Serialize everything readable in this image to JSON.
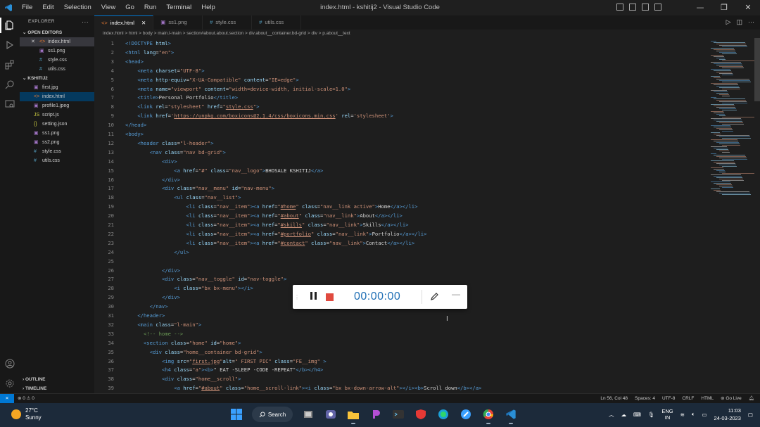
{
  "window": {
    "title": "index.html - kshitij2 - Visual Studio Code",
    "menu": [
      "File",
      "Edit",
      "Selection",
      "View",
      "Go",
      "Run",
      "Terminal",
      "Help"
    ]
  },
  "explorer": {
    "header": "EXPLORER",
    "open_editors_label": "OPEN EDITORS",
    "open_editors": [
      {
        "name": "index.html",
        "type": "html"
      },
      {
        "name": "ss1.png",
        "type": "png"
      },
      {
        "name": "style.css",
        "type": "css"
      },
      {
        "name": "utils.css",
        "type": "css"
      }
    ],
    "folder_label": "KSHITIJ2",
    "files": [
      {
        "name": "first.jpg",
        "type": "jpg",
        "icon": "▣"
      },
      {
        "name": "index.html",
        "type": "html",
        "icon": "<>"
      },
      {
        "name": "profile1.jpeg",
        "type": "jpg",
        "icon": "▣"
      },
      {
        "name": "script.js",
        "type": "js",
        "icon": "JS"
      },
      {
        "name": "setting.json",
        "type": "json",
        "icon": "{}"
      },
      {
        "name": "ss1.png",
        "type": "png",
        "icon": "▣"
      },
      {
        "name": "ss2.png",
        "type": "png",
        "icon": "▣"
      },
      {
        "name": "style.css",
        "type": "css",
        "icon": "#"
      },
      {
        "name": "utils.css",
        "type": "css",
        "icon": "#"
      }
    ],
    "outline_label": "OUTLINE",
    "timeline_label": "TIMELINE"
  },
  "tabs": [
    {
      "name": "index.html",
      "icon": "<>",
      "active": true
    },
    {
      "name": "ss1.png",
      "icon": "▣",
      "active": false
    },
    {
      "name": "style.css",
      "icon": "#",
      "active": false
    },
    {
      "name": "utils.css",
      "icon": "#",
      "active": false
    }
  ],
  "breadcrumb": "index.html > html > body > main.l-main > section#about.about.section > div.about__container.bd-grid > div > p.about__text",
  "code": [
    {
      "n": "1",
      "html": "<span class=\"tg\">&lt;!DOCTYPE</span> <span class=\"at\">html</span><span class=\"tg\">&gt;</span>"
    },
    {
      "n": "2",
      "html": "<span class=\"tg\">&lt;html</span> <span class=\"at\">lang</span><span class=\"tx\">=</span><span class=\"st\">\"en\"</span><span class=\"tg\">&gt;</span>"
    },
    {
      "n": "3",
      "html": "<span class=\"tg\">&lt;head&gt;</span>"
    },
    {
      "n": "4",
      "html": "    <span class=\"tg\">&lt;meta</span> <span class=\"at\">charset</span><span class=\"tx\">=</span><span class=\"st\">\"UTF-8\"</span><span class=\"tg\">&gt;</span>"
    },
    {
      "n": "5",
      "html": "    <span class=\"tg\">&lt;meta</span> <span class=\"at\">http-equiv</span><span class=\"tx\">=</span><span class=\"st\">\"X-UA-Compatible\"</span> <span class=\"at\">content</span><span class=\"tx\">=</span><span class=\"st\">\"IE=edge\"</span><span class=\"tg\">&gt;</span>"
    },
    {
      "n": "6",
      "html": "    <span class=\"tg\">&lt;meta</span> <span class=\"at\">name</span><span class=\"tx\">=</span><span class=\"st\">\"viewport\"</span> <span class=\"at\">content</span><span class=\"tx\">=</span><span class=\"st\">\"width=device-width, initial-scale=1.0\"</span><span class=\"tg\">&gt;</span>"
    },
    {
      "n": "7",
      "html": "    <span class=\"tg\">&lt;title&gt;</span><span class=\"tx\">Personal Portfolio</span><span class=\"tg\">&lt;/title&gt;</span>"
    },
    {
      "n": "8",
      "html": "    <span class=\"tg\">&lt;link</span> <span class=\"at\">rel</span><span class=\"tx\">=</span><span class=\"st\">\"stylesheet\"</span> <span class=\"at\">href</span><span class=\"tx\">=</span><span class=\"st\">\"<u>style.css</u>\"</span><span class=\"tg\">&gt;</span>"
    },
    {
      "n": "9",
      "html": "    <span class=\"tg\">&lt;link</span> <span class=\"at\">href</span><span class=\"tx\">=</span><span class=\"st\">'<u>https://unpkg.com/boxicons@2.1.4/css/boxicons.min.css</u>'</span> <span class=\"at\">rel</span><span class=\"tx\">=</span><span class=\"st\">'stylesheet'</span><span class=\"tg\">&gt;</span>"
    },
    {
      "n": "10",
      "html": "<span class=\"tg\">&lt;/head&gt;</span>"
    },
    {
      "n": "11",
      "html": "<span class=\"tg\">&lt;body&gt;</span>"
    },
    {
      "n": "12",
      "html": "    <span class=\"tg\">&lt;header</span> <span class=\"at\">class</span><span class=\"tx\">=</span><span class=\"st\">\"l-header\"</span><span class=\"tg\">&gt;</span>"
    },
    {
      "n": "13",
      "html": "        <span class=\"tg\">&lt;nav</span> <span class=\"at\">class</span><span class=\"tx\">=</span><span class=\"st\">\"nav bd-grid\"</span><span class=\"tg\">&gt;</span>"
    },
    {
      "n": "14",
      "html": "            <span class=\"tg\">&lt;div&gt;</span>"
    },
    {
      "n": "15",
      "html": "                <span class=\"tg\">&lt;a</span> <span class=\"at\">href</span><span class=\"tx\">=</span><span class=\"st\">\"#\"</span> <span class=\"at\">class</span><span class=\"tx\">=</span><span class=\"st\">\"nav__logo\"</span><span class=\"tg\">&gt;</span><span class=\"tx\">BHOSALE KSHITIJ</span><span class=\"tg\">&lt;/a&gt;</span>"
    },
    {
      "n": "16",
      "html": "            <span class=\"tg\">&lt;/div&gt;</span>"
    },
    {
      "n": "17",
      "html": "            <span class=\"tg\">&lt;div</span> <span class=\"at\">class</span><span class=\"tx\">=</span><span class=\"st\">\"nav__menu\"</span> <span class=\"at\">id</span><span class=\"tx\">=</span><span class=\"st\">\"nav-menu\"</span><span class=\"tg\">&gt;</span>"
    },
    {
      "n": "18",
      "html": "                <span class=\"tg\">&lt;ul</span> <span class=\"at\">class</span><span class=\"tx\">=</span><span class=\"st\">\"nav__list\"</span><span class=\"tg\">&gt;</span>"
    },
    {
      "n": "19",
      "html": "                    <span class=\"tg\">&lt;li</span> <span class=\"at\">class</span><span class=\"tx\">=</span><span class=\"st\">\"nav__item\"</span><span class=\"tg\">&gt;&lt;a</span> <span class=\"at\">href</span><span class=\"tx\">=</span><span class=\"st\">\"<u>#home</u>\"</span> <span class=\"at\">class</span><span class=\"tx\">=</span><span class=\"st\">\"nav__link active\"</span><span class=\"tg\">&gt;</span><span class=\"tx\">Home</span><span class=\"tg\">&lt;/a&gt;&lt;/li&gt;</span>"
    },
    {
      "n": "20",
      "html": "                    <span class=\"tg\">&lt;li</span> <span class=\"at\">class</span><span class=\"tx\">=</span><span class=\"st\">\"nav__item\"</span><span class=\"tg\">&gt;&lt;a</span> <span class=\"at\">href</span><span class=\"tx\">=</span><span class=\"st\">\"<u>#about</u>\"</span> <span class=\"at\">class</span><span class=\"tx\">=</span><span class=\"st\">\"nav__link\"</span><span class=\"tg\">&gt;</span><span class=\"tx\">About</span><span class=\"tg\">&lt;/a&gt;&lt;/li&gt;</span>"
    },
    {
      "n": "21",
      "html": "                    <span class=\"tg\">&lt;li</span> <span class=\"at\">class</span><span class=\"tx\">=</span><span class=\"st\">\"nav__item\"</span><span class=\"tg\">&gt;&lt;a</span> <span class=\"at\">href</span><span class=\"tx\">=</span><span class=\"st\">\"<u>#skills</u>\"</span> <span class=\"at\">class</span><span class=\"tx\">=</span><span class=\"st\">\"nav__link\"</span><span class=\"tg\">&gt;</span><span class=\"tx\">Skills</span><span class=\"tg\">&lt;/a&gt;&lt;/li&gt;</span>"
    },
    {
      "n": "22",
      "html": "                    <span class=\"tg\">&lt;li</span> <span class=\"at\">class</span><span class=\"tx\">=</span><span class=\"st\">\"nav__item\"</span><span class=\"tg\">&gt;&lt;a</span> <span class=\"at\">href</span><span class=\"tx\">=</span><span class=\"st\">\"<u>#portfolio</u>\"</span> <span class=\"at\">class</span><span class=\"tx\">=</span><span class=\"st\">\"nav__link\"</span><span class=\"tg\">&gt;</span><span class=\"tx\">Portfolio</span><span class=\"tg\">&lt;/a&gt;&lt;/li&gt;</span>"
    },
    {
      "n": "23",
      "html": "                    <span class=\"tg\">&lt;li</span> <span class=\"at\">class</span><span class=\"tx\">=</span><span class=\"st\">\"nav__item\"</span><span class=\"tg\">&gt;&lt;a</span> <span class=\"at\">href</span><span class=\"tx\">=</span><span class=\"st\">\"<u>#contact</u>\"</span> <span class=\"at\">class</span><span class=\"tx\">=</span><span class=\"st\">\"nav__link\"</span><span class=\"tg\">&gt;</span><span class=\"tx\">Contact</span><span class=\"tg\">&lt;/a&gt;&lt;/li&gt;</span>"
    },
    {
      "n": "24",
      "html": "                <span class=\"tg\">&lt;/ul&gt;</span>"
    },
    {
      "n": "25",
      "html": ""
    },
    {
      "n": "26",
      "html": "            <span class=\"tg\">&lt;/div&gt;</span>"
    },
    {
      "n": "27",
      "html": "            <span class=\"tg\">&lt;div</span> <span class=\"at\">class</span><span class=\"tx\">=</span><span class=\"st\">\"nav__toggle\"</span> <span class=\"at\">id</span><span class=\"tx\">=</span><span class=\"st\">\"nav-toggle\"</span><span class=\"tg\">&gt;</span>"
    },
    {
      "n": "28",
      "html": "                <span class=\"tg\">&lt;i</span> <span class=\"at\">class</span><span class=\"tx\">=</span><span class=\"st\">\"bx bx-menu\"</span><span class=\"tg\">&gt;&lt;/i&gt;</span>"
    },
    {
      "n": "29",
      "html": "            <span class=\"tg\">&lt;/div&gt;</span>"
    },
    {
      "n": "30",
      "html": "        <span class=\"tg\">&lt;/nav&gt;</span>"
    },
    {
      "n": "31",
      "html": "    <span class=\"tg\">&lt;/header&gt;</span>"
    },
    {
      "n": "32",
      "html": "    <span class=\"tg\">&lt;main</span> <span class=\"at\">class</span><span class=\"tx\">=</span><span class=\"st\">\"l-main\"</span><span class=\"tg\">&gt;</span>"
    },
    {
      "n": "33",
      "html": "      <span class=\"cm\">&lt;!-- home --&gt;</span>"
    },
    {
      "n": "34",
      "html": "      <span class=\"tg\">&lt;section</span> <span class=\"at\">class</span><span class=\"tx\">=</span><span class=\"st\">\"home\"</span> <span class=\"at\">id</span><span class=\"tx\">=</span><span class=\"st\">\"home\"</span><span class=\"tg\">&gt;</span>"
    },
    {
      "n": "35",
      "html": "        <span class=\"tg\">&lt;div</span> <span class=\"at\">class</span><span class=\"tx\">=</span><span class=\"st\">\"home__container bd-grid\"</span><span class=\"tg\">&gt;</span>"
    },
    {
      "n": "36",
      "html": "            <span class=\"tg\">&lt;img</span> <span class=\"at\">src</span><span class=\"tx\">=</span><span class=\"st\">\"<u>first.jpg</u>\"</span><span class=\"at\">alt</span><span class=\"tx\">=</span><span class=\"st\">\" FIRST PIC\"</span> <span class=\"at\">class</span><span class=\"tx\">=</span><span class=\"st\">\"FE__img\"</span> <span class=\"tg\">&gt;</span>"
    },
    {
      "n": "37",
      "html": "            <span class=\"tg\">&lt;h4</span> <span class=\"at\">class</span><span class=\"tx\">=</span><span class=\"st\">\"a\"</span><span class=\"tg\">&gt;&lt;b&gt;</span><span class=\"tx\">\" EAT -SLEEP -CODE -REPEAT\"</span><span class=\"tg\">&lt;/b&gt;&lt;/h4&gt;</span>"
    },
    {
      "n": "38",
      "html": "            <span class=\"tg\">&lt;div</span> <span class=\"at\">class</span><span class=\"tx\">=</span><span class=\"st\">\"home__scroll\"</span><span class=\"tg\">&gt;</span>"
    },
    {
      "n": "39",
      "html": "                <span class=\"tg\">&lt;a</span> <span class=\"at\">href</span><span class=\"tx\">=</span><span class=\"st\">\"<u>#about</u>\"</span> <span class=\"at\">class</span><span class=\"tx\">=</span><span class=\"st\">\"home__scroll-link\"</span><span class=\"tg\">&gt;&lt;i</span> <span class=\"at\">class</span><span class=\"tx\">=</span><span class=\"st\">\"bx bx-down-arrow-alt\"</span><span class=\"tg\">&gt;&lt;/i&gt;&lt;b&gt;</span><span class=\"tx\">Scroll down</span><span class=\"tg\">&lt;/b&gt;&lt;/a&gt;</span>"
    }
  ],
  "recorder": {
    "time": "00:00:00"
  },
  "status": {
    "remote": "⨯",
    "errors": "⊗ 0 ⚠ 0",
    "position": "Ln 56, Col 48",
    "spaces": "Spaces: 4",
    "encoding": "UTF-8",
    "eol": "CRLF",
    "language": "HTML",
    "golive": "Go Live"
  },
  "taskbar": {
    "temp": "27°C",
    "weather": "Sunny",
    "search": "Search",
    "lang1": "ENG",
    "lang2": "IN",
    "time": "11:03",
    "date": "24-03-2023"
  }
}
